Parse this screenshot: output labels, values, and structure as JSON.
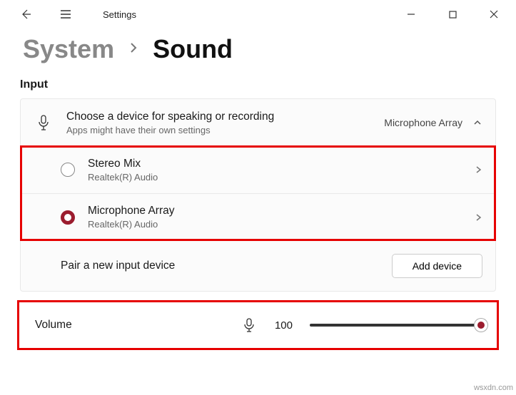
{
  "window": {
    "title": "Settings"
  },
  "breadcrumb": {
    "system": "System",
    "sound": "Sound"
  },
  "section": {
    "input": "Input"
  },
  "choose": {
    "title": "Choose a device for speaking or recording",
    "subtitle": "Apps might have their own settings",
    "current": "Microphone Array"
  },
  "devices": [
    {
      "name": "Stereo Mix",
      "driver": "Realtek(R) Audio",
      "selected": false
    },
    {
      "name": "Microphone Array",
      "driver": "Realtek(R) Audio",
      "selected": true
    }
  ],
  "pair": {
    "label": "Pair a new input device",
    "button": "Add device"
  },
  "volume": {
    "label": "Volume",
    "value": "100"
  },
  "watermark": "wsxdn.com"
}
